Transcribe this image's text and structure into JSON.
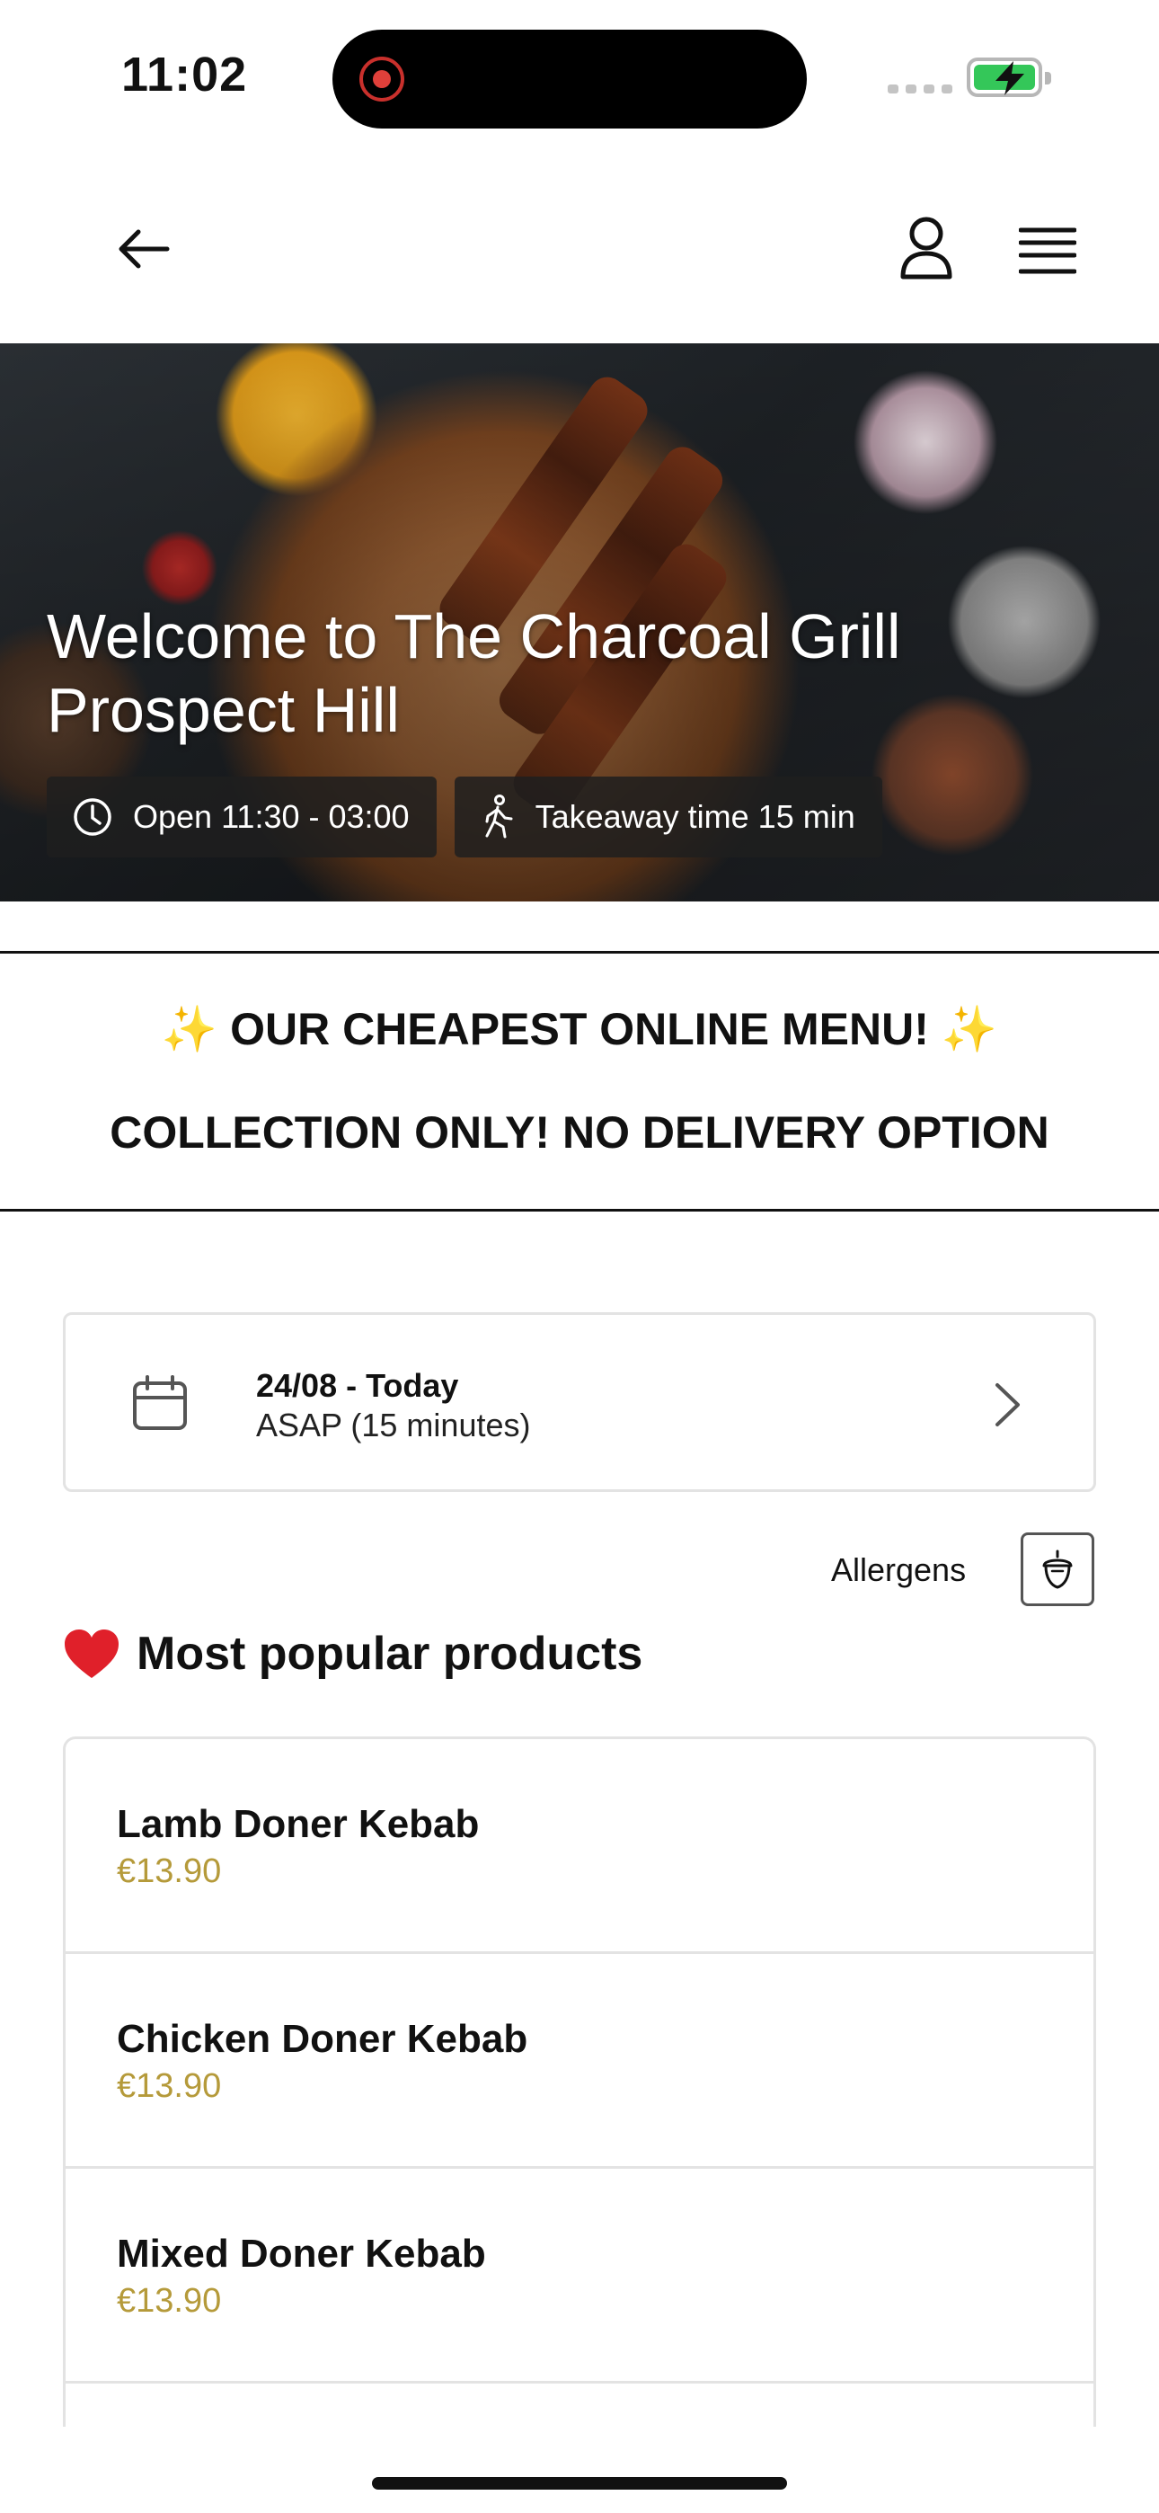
{
  "status_bar": {
    "time": "11:02"
  },
  "icons": {
    "back": "arrow-left-icon",
    "user": "user-icon",
    "menu": "hamburger-menu-icon",
    "clock": "clock-icon",
    "walking": "walking-person-icon",
    "calendar": "calendar-icon",
    "chevron": "chevron-right-icon",
    "allergens": "acorn-icon",
    "heart": "heart-icon"
  },
  "hero": {
    "title_line1": "Welcome to The Charcoal Grill",
    "title_line2": "Prospect Hill",
    "open_hours": "Open 11:30 - 03:00",
    "takeaway_time": "Takeaway time 15 min"
  },
  "promo": {
    "line1_sparkle_left": "✨",
    "line1_text": "OUR CHEAPEST ONLINE MENU!",
    "line1_sparkle_right": "✨",
    "line2_text": "COLLECTION ONLY! NO DELIVERY OPTION"
  },
  "schedule": {
    "date_label": "24/08 - Today",
    "time_label": "ASAP (15 minutes)"
  },
  "allergens": {
    "label": "Allergens"
  },
  "popular": {
    "title": "Most popular products",
    "products": [
      {
        "name": "Lamb Doner Kebab",
        "price": "€13.90"
      },
      {
        "name": "Chicken Doner Kebab",
        "price": "€13.90"
      },
      {
        "name": "Mixed Doner Kebab",
        "price": "€13.90"
      }
    ]
  },
  "colors": {
    "price": "#b59a3a",
    "battery": "#34c759",
    "heart": "#e0202a"
  }
}
